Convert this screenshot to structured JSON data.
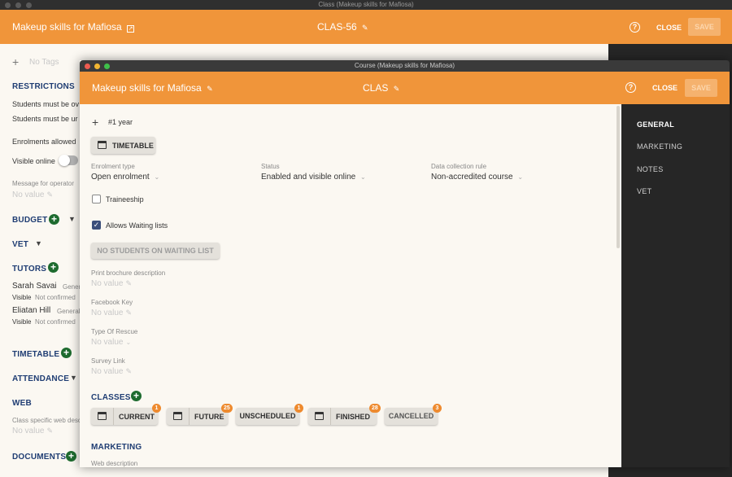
{
  "outer": {
    "window_title": "Class (Makeup skills for Mafiosa)",
    "header_title": "Makeup skills for Mafiosa",
    "header_code": "CLAS-56",
    "close_label": "CLOSE",
    "save_label": "SAVE",
    "tags_placeholder": "No Tags",
    "restrictions": {
      "title": "RESTRICTIONS",
      "line1": "Students must be ov",
      "line2": "Students must be ur",
      "line3": "Enrolments allowed"
    },
    "visible_online_label": "Visible online",
    "message_label": "Message for operator",
    "no_value": "No value",
    "budget": "BUDGET",
    "vet": "VET",
    "tutors": {
      "title": "TUTORS",
      "items": [
        {
          "name": "Sarah Savai",
          "role": "Gener",
          "visible": "Visible",
          "status": "Not confirmed"
        },
        {
          "name": "Eliatan Hill",
          "role": "General",
          "visible": "Visible",
          "status": "Not confirmed"
        }
      ]
    },
    "timetable": "TIMETABLE",
    "attendance": "ATTENDANCE",
    "web": {
      "title": "WEB",
      "desc_label": "Class specific web desc"
    },
    "documents": "DOCUMENTS"
  },
  "inner": {
    "window_title": "Course (Makeup skills for Mafiosa)",
    "header_title": "Makeup skills for Mafiosa",
    "header_code": "CLAS",
    "close_label": "CLOSE",
    "save_label": "SAVE",
    "tag": "#1 year",
    "timetable_button": "TIMETABLE",
    "enrolment_type": {
      "label": "Enrolment type",
      "value": "Open enrolment"
    },
    "status": {
      "label": "Status",
      "value": "Enabled and visible online"
    },
    "data_collection": {
      "label": "Data collection rule",
      "value": "Non-accredited course"
    },
    "traineeship_label": "Traineeship",
    "waiting_lists_label": "Allows Waiting lists",
    "waiting_list_button": "NO STUDENTS ON WAITING LIST",
    "print_brochure": {
      "label": "Print brochure description",
      "value": "No value"
    },
    "facebook_key": {
      "label": "Facebook Key",
      "value": "No value"
    },
    "type_of_rescue": {
      "label": "Type Of Rescue",
      "value": "No value"
    },
    "survey_link": {
      "label": "Survey Link",
      "value": "No value"
    },
    "classes": {
      "title": "CLASSES",
      "tabs": [
        {
          "label": "CURRENT",
          "count": "1"
        },
        {
          "label": "FUTURE",
          "count": "25"
        },
        {
          "label": "UNSCHEDULED",
          "count": "1"
        },
        {
          "label": "FINISHED",
          "count": "28"
        },
        {
          "label": "CANCELLED",
          "count": "3"
        }
      ]
    },
    "marketing": {
      "title": "MARKETING",
      "web_description_label": "Web description"
    },
    "side_nav": [
      "GENERAL",
      "MARKETING",
      "NOTES",
      "VET"
    ],
    "side_nav_active": "GENERAL"
  },
  "colors": {
    "header_orange": "#f0953a",
    "section_blue": "#1f3d73",
    "add_green": "#1e6b2f",
    "badge_orange": "#ee8a2e",
    "side_dark": "#262626"
  }
}
